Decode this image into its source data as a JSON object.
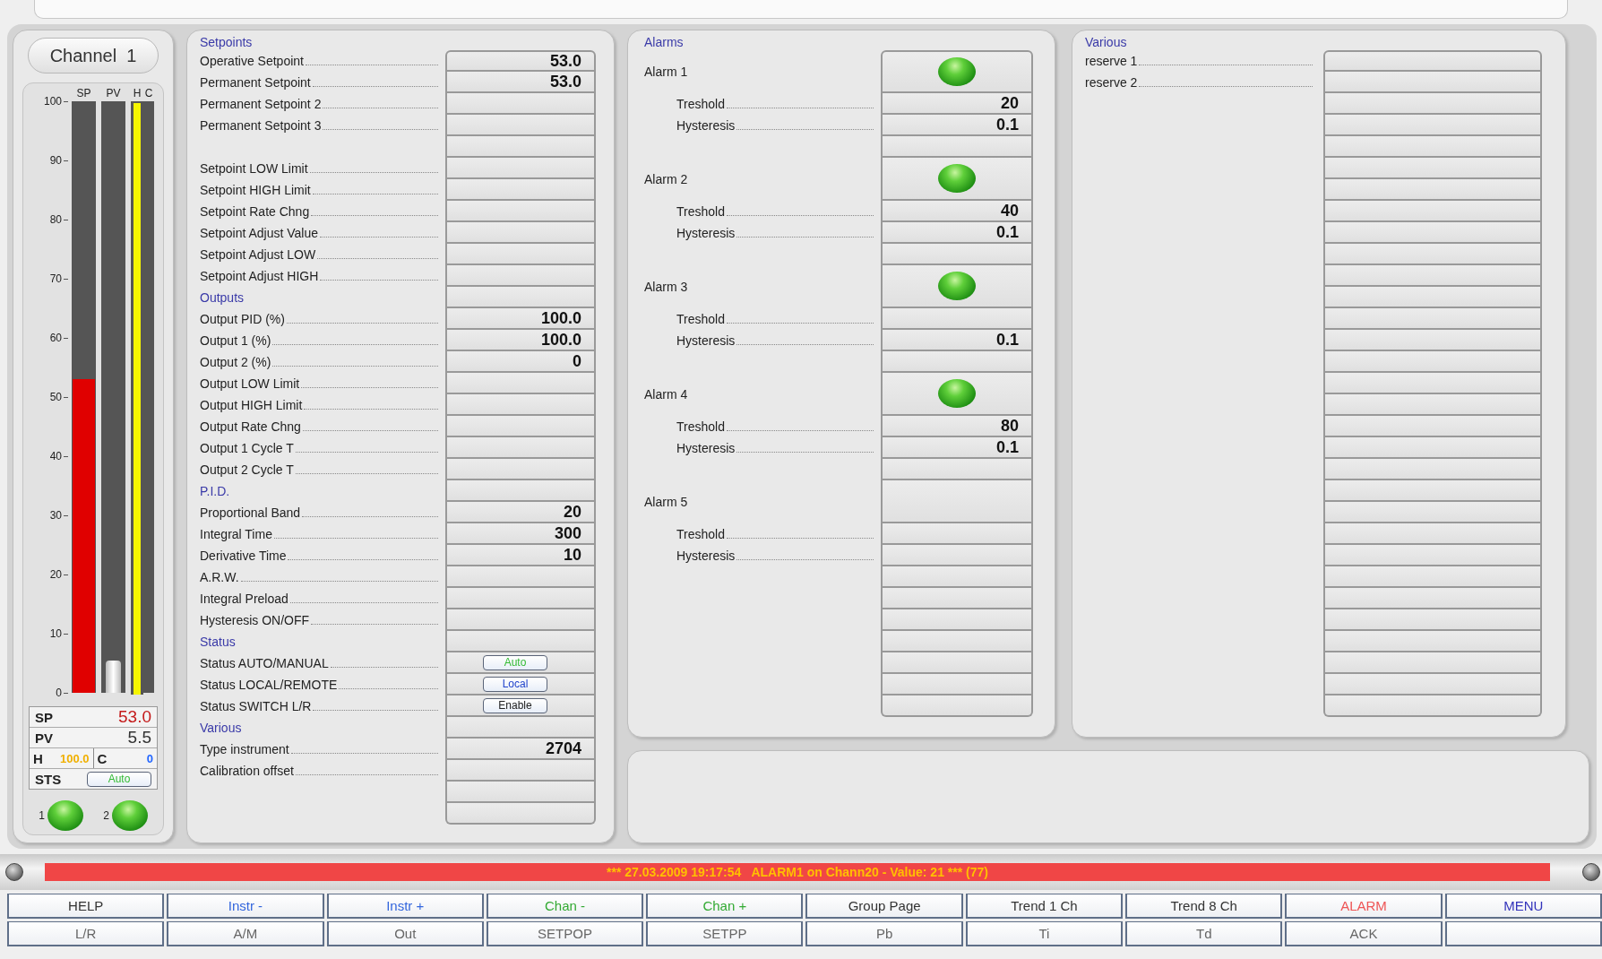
{
  "channel": {
    "title": "Channel  1",
    "scale": [
      "100",
      "90",
      "80",
      "70",
      "60",
      "50",
      "40",
      "30",
      "20",
      "10",
      "0"
    ],
    "bars": [
      {
        "label": "SP",
        "level": 0.53,
        "color": "#e00000"
      },
      {
        "label": "PV",
        "level": 0.055,
        "color": "#f2f2f2"
      },
      {
        "label": "H",
        "level": 1.0,
        "color": "#f5f500"
      },
      {
        "label": "C"
      }
    ],
    "readouts": [
      {
        "label": "SP",
        "value": "53.0",
        "color": "#c41a1a"
      },
      {
        "label": "PV",
        "value": "5.5",
        "color": "#333333"
      }
    ],
    "limits": [
      {
        "label": "H",
        "value": "100.0",
        "color": "#f0b000"
      },
      {
        "label": "C",
        "value": "0",
        "color": "#2266ff"
      }
    ],
    "sts": {
      "label": "STS",
      "button": {
        "label": "Auto",
        "color": "#33bb33"
      }
    },
    "leds": [
      {
        "label": "1",
        "on": true
      },
      {
        "label": "2",
        "on": true
      }
    ]
  },
  "setpoints": {
    "title": "Setpoints",
    "rows": [
      {
        "kind": "field",
        "label": "Operative Setpoint",
        "value": "53.0"
      },
      {
        "kind": "field",
        "label": "Permanent Setpoint",
        "value": "53.0"
      },
      {
        "kind": "field",
        "label": "Permanent Setpoint 2"
      },
      {
        "kind": "field",
        "label": "Permanent Setpoint 3"
      },
      {
        "kind": "blank"
      },
      {
        "kind": "field",
        "label": "Setpoint LOW Limit"
      },
      {
        "kind": "field",
        "label": "Setpoint HIGH Limit"
      },
      {
        "kind": "field",
        "label": "Setpoint Rate Chng"
      },
      {
        "kind": "field",
        "label": "Setpoint Adjust Value"
      },
      {
        "kind": "field",
        "label": "Setpoint Adjust LOW"
      },
      {
        "kind": "field",
        "label": "Setpoint Adjust HIGH"
      },
      {
        "kind": "header",
        "label": "Outputs"
      },
      {
        "kind": "field",
        "label": "Output PID (%)",
        "value": "100.0"
      },
      {
        "kind": "field",
        "label": "Output 1 (%)",
        "value": "100.0"
      },
      {
        "kind": "field",
        "label": "Output 2 (%)",
        "value": "0"
      },
      {
        "kind": "field",
        "label": "Output LOW Limit"
      },
      {
        "kind": "field",
        "label": "Output HIGH Limit"
      },
      {
        "kind": "field",
        "label": "Output Rate Chng"
      },
      {
        "kind": "field",
        "label": "Output 1 Cycle T"
      },
      {
        "kind": "field",
        "label": "Output 2 Cycle T"
      },
      {
        "kind": "header",
        "label": "P.I.D."
      },
      {
        "kind": "field",
        "label": "Proportional Band",
        "value": "20"
      },
      {
        "kind": "field",
        "label": "Integral Time",
        "value": "300"
      },
      {
        "kind": "field",
        "label": "Derivative Time",
        "value": "10"
      },
      {
        "kind": "field",
        "label": "A.R.W."
      },
      {
        "kind": "field",
        "label": "Integral Preload"
      },
      {
        "kind": "field",
        "label": "Hysteresis ON/OFF"
      },
      {
        "kind": "header",
        "label": "Status"
      },
      {
        "kind": "field",
        "label": "Status AUTO/MANUAL",
        "button": {
          "label": "Auto",
          "color": "#33bb33"
        }
      },
      {
        "kind": "field",
        "label": "Status LOCAL/REMOTE",
        "button": {
          "label": "Local",
          "color": "#2244cc"
        }
      },
      {
        "kind": "field",
        "label": "Status SWITCH L/R",
        "button": {
          "label": "Enable",
          "color": "#222222"
        }
      },
      {
        "kind": "header",
        "label": "Various"
      },
      {
        "kind": "field",
        "label": "Type instrument",
        "value": "2704"
      },
      {
        "kind": "field",
        "label": "Calibration offset"
      },
      {
        "kind": "blank"
      },
      {
        "kind": "blank"
      }
    ]
  },
  "alarms": {
    "title": "Alarms",
    "items": [
      {
        "name": "Alarm 1",
        "led": true,
        "rows": [
          {
            "label": "Treshold",
            "value": "20"
          },
          {
            "label": "Hysteresis",
            "value": "0.1"
          }
        ]
      },
      {
        "name": "Alarm 2",
        "led": true,
        "rows": [
          {
            "label": "Treshold",
            "value": "40"
          },
          {
            "label": "Hysteresis",
            "value": "0.1"
          }
        ]
      },
      {
        "name": "Alarm 3",
        "led": true,
        "rows": [
          {
            "label": "Treshold"
          },
          {
            "label": "Hysteresis",
            "value": "0.1"
          }
        ]
      },
      {
        "name": "Alarm 4",
        "led": true,
        "rows": [
          {
            "label": "Treshold",
            "value": "80"
          },
          {
            "label": "Hysteresis",
            "value": "0.1"
          }
        ]
      },
      {
        "name": "Alarm 5",
        "led": false,
        "rows": [
          {
            "label": "Treshold"
          },
          {
            "label": "Hysteresis"
          }
        ]
      }
    ]
  },
  "various": {
    "title": "Various",
    "rows": [
      {
        "label": "reserve 1"
      },
      {
        "label": "reserve 2"
      }
    ]
  },
  "alarm_banner": "*** 27.03.2009 19:17:54   ALARM1 on Chann20 - Value: 21 *** (77)",
  "buttons": [
    [
      {
        "label": "HELP",
        "color": "#333333"
      },
      {
        "label": "Instr -",
        "color": "#3366dd"
      },
      {
        "label": "Instr +",
        "color": "#3366dd"
      },
      {
        "label": "Chan -",
        "color": "#33aa33"
      },
      {
        "label": "Chan +",
        "color": "#33aa33"
      },
      {
        "label": "Group Page",
        "color": "#333333"
      },
      {
        "label": "Trend 1 Ch",
        "color": "#333333"
      },
      {
        "label": "Trend 8 Ch",
        "color": "#333333"
      },
      {
        "label": "ALARM",
        "color": "#ee5555"
      },
      {
        "label": "MENU",
        "color": "#3333bb"
      }
    ],
    [
      {
        "label": "L/R",
        "color": "#666666"
      },
      {
        "label": "A/M",
        "color": "#666666"
      },
      {
        "label": "Out",
        "color": "#666666"
      },
      {
        "label": "SETPOP",
        "color": "#666666"
      },
      {
        "label": "SETPP",
        "color": "#666666"
      },
      {
        "label": "Pb",
        "color": "#666666"
      },
      {
        "label": "Ti",
        "color": "#666666"
      },
      {
        "label": "Td",
        "color": "#666666"
      },
      {
        "label": "ACK",
        "color": "#666666"
      }
    ]
  ]
}
